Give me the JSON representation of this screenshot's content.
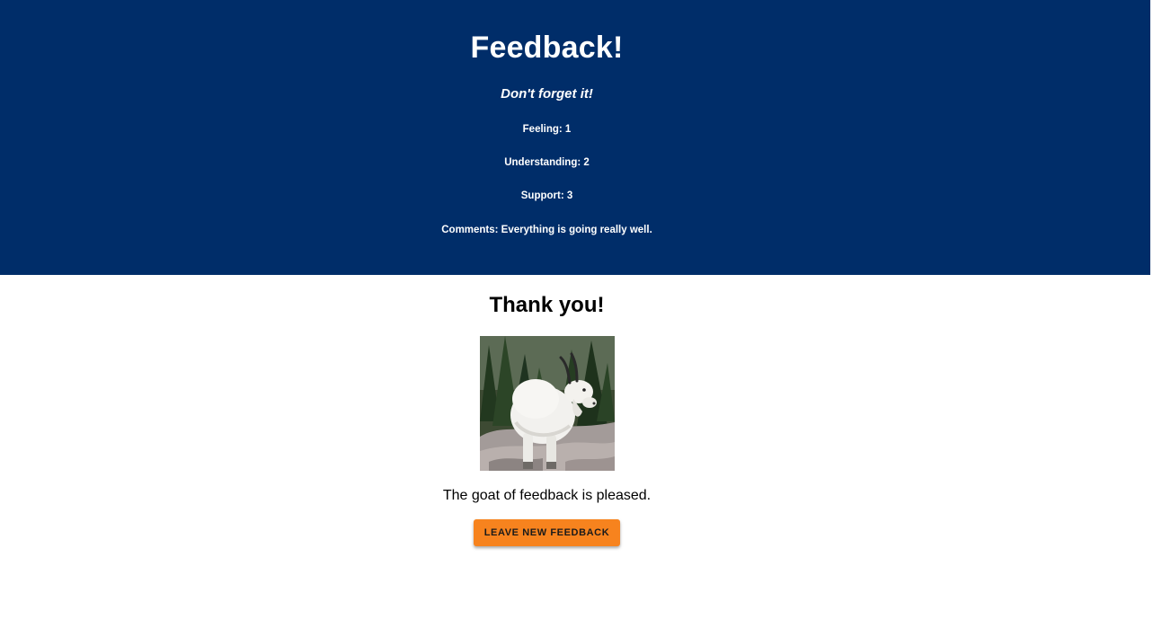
{
  "header": {
    "title": "Feedback!",
    "subtitle": "Don't forget it!",
    "stats": {
      "feeling": "Feeling: 1",
      "understanding": "Understanding: 2",
      "support": "Support: 3",
      "comments": "Comments: Everything is going really well."
    }
  },
  "main": {
    "thanks": "Thank you!",
    "image_subject": "mountain-goat",
    "caption": "The goat of feedback is pleased.",
    "button_label": "LEAVE NEW FEEDBACK"
  },
  "colors": {
    "header_bg": "#002d69",
    "button_bg": "#f7831e"
  }
}
